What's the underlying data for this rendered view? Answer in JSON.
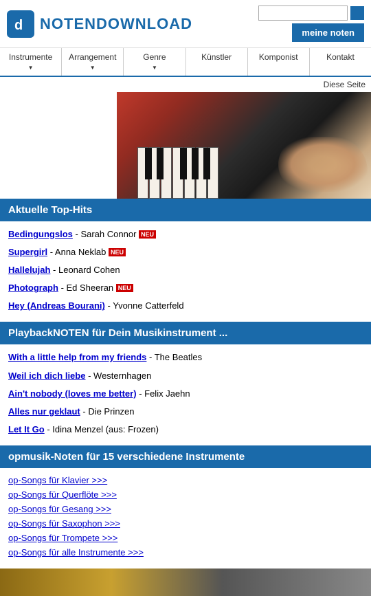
{
  "header": {
    "logo_text": "NOTENDOWNLOAD",
    "search_placeholder": "",
    "meine_noten": "meine noten"
  },
  "nav": {
    "items": [
      {
        "label": "Instrumente",
        "has_dropdown": true
      },
      {
        "label": "Arrangement",
        "has_dropdown": true
      },
      {
        "label": "Genre",
        "has_dropdown": true
      },
      {
        "label": "Künstler",
        "has_dropdown": false
      },
      {
        "label": "Komponist",
        "has_dropdown": false
      },
      {
        "label": "Kontakt",
        "has_dropdown": false
      }
    ]
  },
  "diese_seite": "Diese Seite",
  "top_hits": {
    "section_title": "Aktuelle Top-Hits",
    "items": [
      {
        "link": "Bedingungslos",
        "artist": "Sarah Connor",
        "neu": true
      },
      {
        "link": "Supergirl",
        "artist": "Anna Neklab",
        "neu": true
      },
      {
        "link": "Hallelujah",
        "artist": "Leonard Cohen",
        "neu": false
      },
      {
        "link": "Photograph",
        "artist": "Ed Sheeran",
        "neu": true
      },
      {
        "link": "Hey (Andreas Bourani)",
        "artist": "Yvonne Catterfeld",
        "neu": false
      }
    ]
  },
  "playback": {
    "section_title": "PlaybackNOTEN für Dein Musikinstrument ...",
    "items": [
      {
        "link": "With a little help from my friends",
        "artist": "The Beatles"
      },
      {
        "link": "Weil ich dich liebe",
        "artist": "Westernhagen"
      },
      {
        "link": "Ain't nobody (loves me better)",
        "artist": "Felix Jaehn"
      },
      {
        "link": "Alles nur geklaut",
        "artist": "Die Prinzen"
      },
      {
        "link": "Let It Go",
        "artist": "Idina Menzel (aus: Frozen)"
      }
    ]
  },
  "pop_songs": {
    "section_title": "opmusik-Noten für 15 verschiedene Instrumente",
    "links": [
      "op-Songs für Klavier >>>",
      "op-Songs für Querflöte >>>",
      "op-Songs für Gesang >>>",
      "op-Songs für Saxophon >>>",
      "op-Songs für Trompete >>>",
      "op-Songs für alle Instrumente >>>"
    ]
  },
  "neu_label": "NEU"
}
